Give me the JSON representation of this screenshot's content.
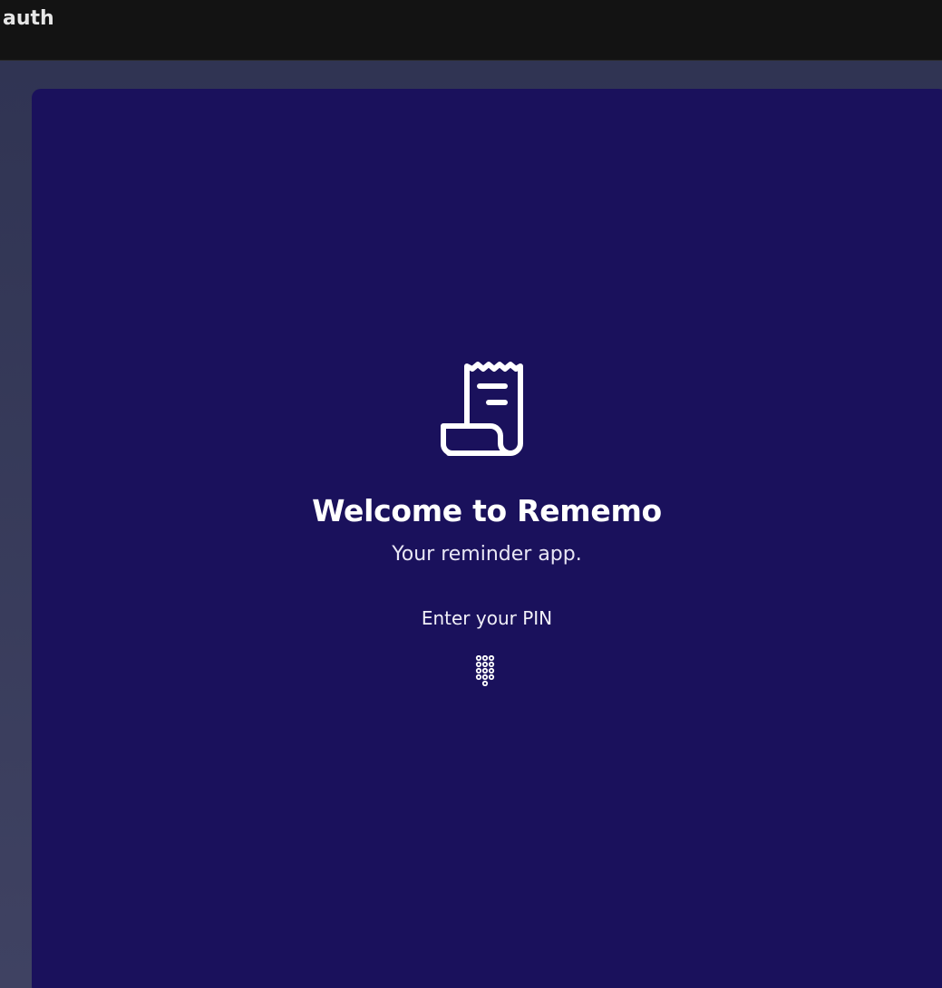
{
  "window": {
    "title": "auth"
  },
  "welcome": {
    "logo_icon": "receipt-scroll-icon",
    "headline": "Welcome to Rememo",
    "subtitle": "Your reminder app.",
    "pin_label": "Enter your PIN",
    "keypad_icon": "dialpad-icon"
  },
  "colors": {
    "titlebar_bg": "#131313",
    "page_bg": "#34385a",
    "card_bg": "#1a115c",
    "text": "#ffffff"
  }
}
